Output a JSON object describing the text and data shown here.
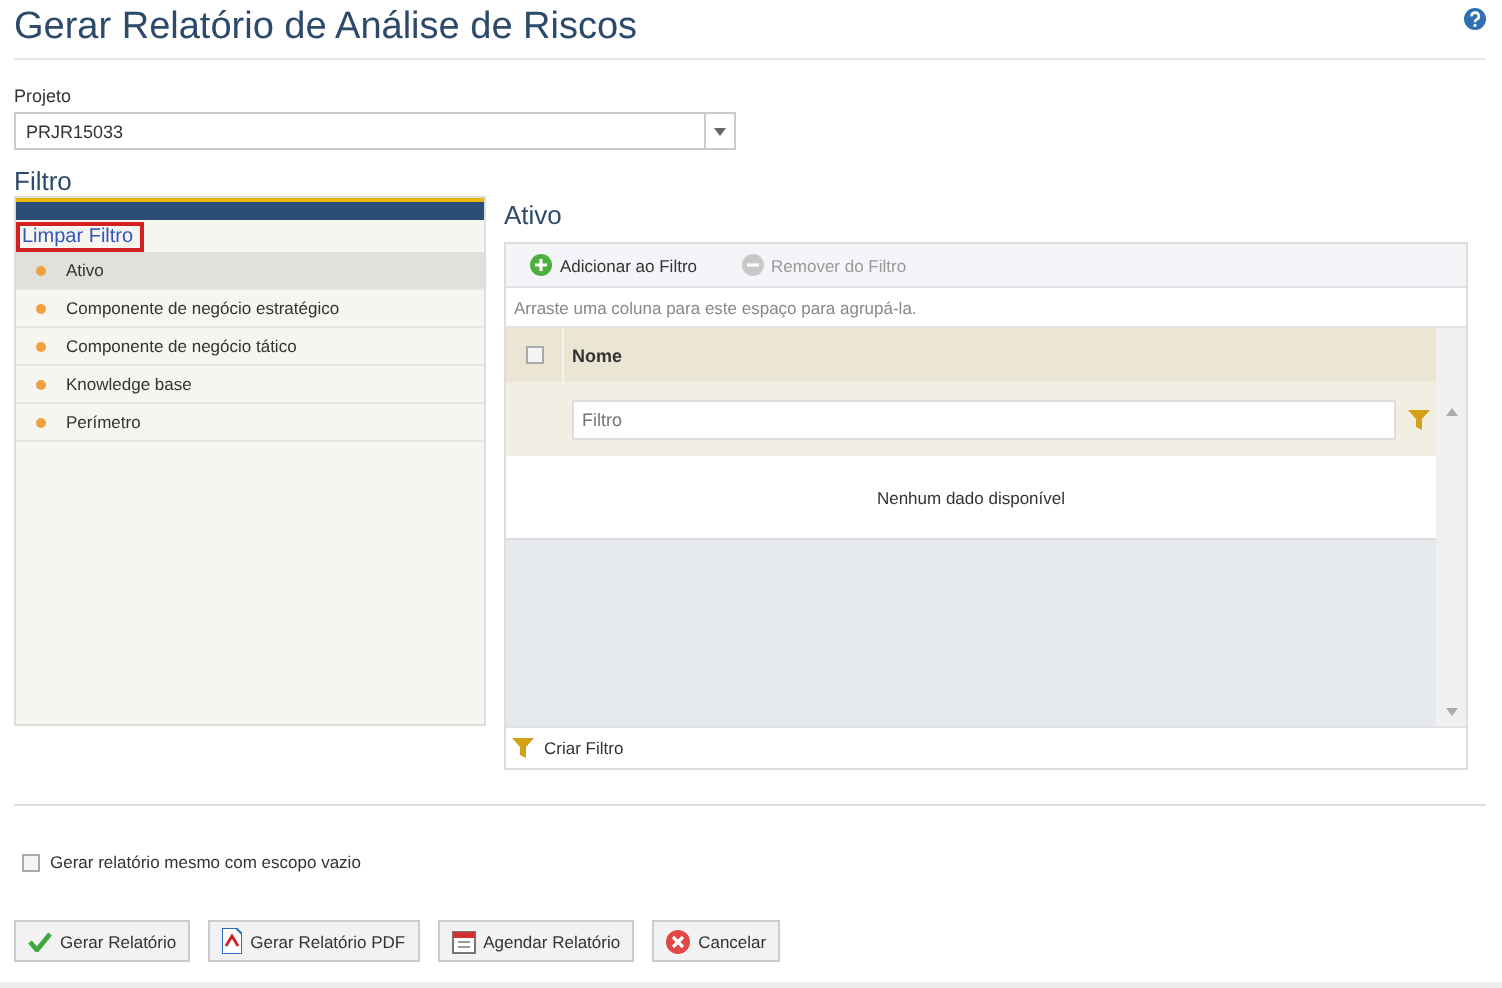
{
  "page_title": "Gerar Relatório de Análise de Riscos",
  "project": {
    "label": "Projeto",
    "value": "PRJR15033"
  },
  "filter_heading": "Filtro",
  "filter_panel": {
    "clear_link": {
      "label": "Limpar Filtro",
      "highlighted": true
    },
    "items": [
      {
        "label": "Ativo",
        "selected": true
      },
      {
        "label": "Componente de negócio estratégico",
        "selected": false
      },
      {
        "label": "Componente de negócio tático",
        "selected": false
      },
      {
        "label": "Knowledge base",
        "selected": false
      },
      {
        "label": "Perímetro",
        "selected": false
      }
    ]
  },
  "grid": {
    "title": "Ativo",
    "toolbar": [
      {
        "label": "Adicionar ao Filtro",
        "kind": "add",
        "disabled": false
      },
      {
        "label": "Remover do Filtro",
        "kind": "remove",
        "disabled": true
      }
    ],
    "group_hint": "Arraste uma coluna para este espaço para agrupá-la.",
    "select_all_checked": false,
    "columns": [
      "Nome"
    ],
    "filter_placeholder": "Filtro",
    "empty_text": "Nenhum dado disponível",
    "footer_button": "Criar Filtro"
  },
  "empty_scope": {
    "label": "Gerar relatório mesmo com escopo vazio",
    "checked": false
  },
  "buttons": [
    {
      "label": "Gerar Relatório",
      "kind": "check"
    },
    {
      "label": "Gerar Relatório PDF",
      "kind": "pdf"
    },
    {
      "label": "Agendar Relatório",
      "kind": "calendar"
    },
    {
      "label": "Cancelar",
      "kind": "cancel"
    }
  ]
}
